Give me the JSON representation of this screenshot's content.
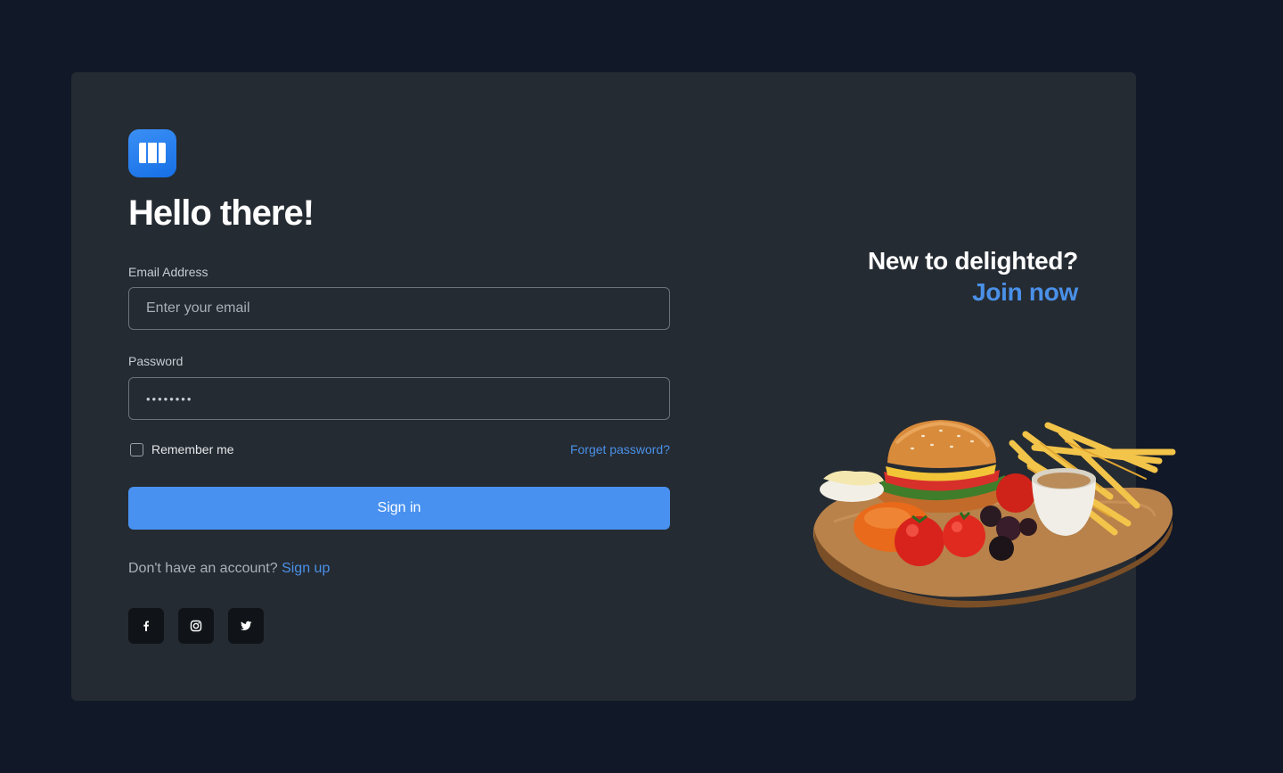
{
  "login": {
    "title": "Hello there!",
    "email_label": "Email Address",
    "email_placeholder": "Enter your email",
    "password_label": "Password",
    "password_value": "••••••••",
    "remember_label": "Remember me",
    "forgot_label": "Forget password?",
    "signin_label": "Sign in",
    "signup_prompt": "Don't have an account?",
    "signup_link": "Sign up"
  },
  "promo": {
    "question": "New to delighted?",
    "join_label": "Join now"
  },
  "socials": [
    {
      "icon": "facebook-icon"
    },
    {
      "icon": "instagram-icon"
    },
    {
      "icon": "twitter-icon"
    }
  ],
  "colors": {
    "background": "#111827",
    "card": "#252b32",
    "accent": "#4891f0",
    "link": "#4a90e8"
  }
}
